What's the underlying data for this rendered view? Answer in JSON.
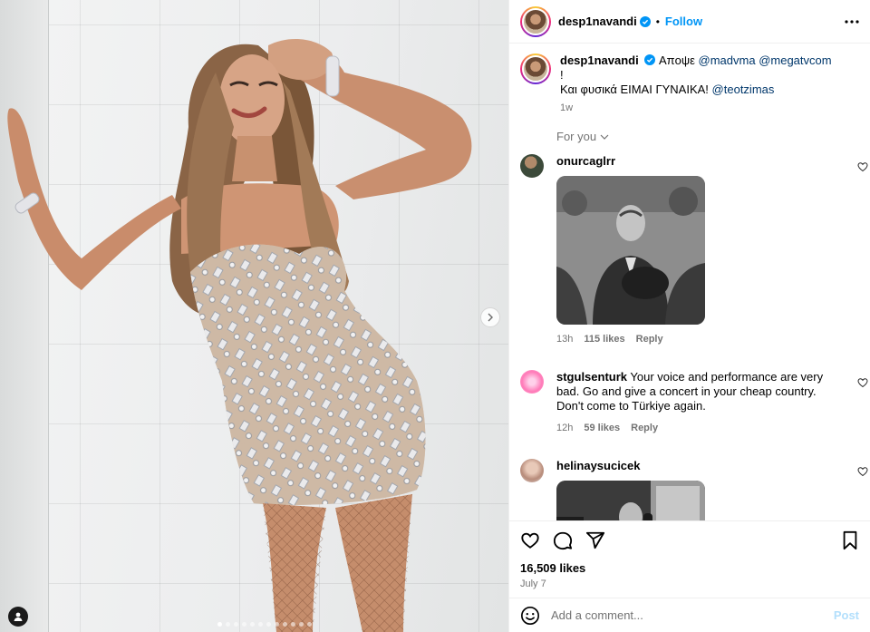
{
  "post": {
    "author": "desp1navandi",
    "follow_label": "Follow",
    "header_dot": "•",
    "caption": {
      "text_1": "Απoψε",
      "mention_1": "@madvma",
      "mention_2": "@megatvcom",
      "text_2": "!",
      "line_2": "Και φυσικά ΕΙΜΑΙ ΓΥΝΑΙΚΑ!",
      "mention_3": "@teotzimas",
      "age": "1w"
    },
    "filter_label": "For you",
    "likes": "16,509 likes",
    "date": "July 7",
    "carousel": {
      "slides": 12,
      "active": 0
    }
  },
  "comments": [
    {
      "user": "onurcaglrr",
      "text": "",
      "age": "13h",
      "likes": "115 likes",
      "reply": "Reply",
      "gif": true
    },
    {
      "user": "stgulsenturk",
      "text": "Your voice and performance are very bad. Go and give a concert in your cheap country. Don't come to Türkiye again.",
      "age": "12h",
      "likes": "59 likes",
      "reply": "Reply"
    },
    {
      "user": "helinaysucicek",
      "text": "",
      "gif": true
    }
  ],
  "composer": {
    "placeholder": "Add a comment...",
    "post_label": "Post"
  },
  "colors": {
    "accent": "#0095f6",
    "link": "#00376b",
    "muted": "#737373",
    "post_disabled": "#b2dffc"
  },
  "icons": [
    "verified-badge-icon",
    "more-options-icon",
    "chevron-down-icon",
    "heart-icon",
    "comment-icon",
    "share-icon",
    "bookmark-icon",
    "emoji-icon",
    "next-arrow-icon",
    "user-tag-icon"
  ]
}
